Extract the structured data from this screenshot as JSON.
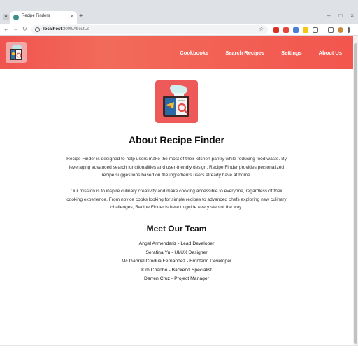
{
  "browser": {
    "tab_title": "Recipe Finders",
    "tab_close": "×",
    "new_tab": "+",
    "url_host": "localhost",
    "url_path": ":3000/AboutUs",
    "window_controls": [
      "–",
      "□",
      "×"
    ],
    "nav_back": "←",
    "nav_forward": "→",
    "nav_reload": "↻",
    "star": "☆"
  },
  "header": {
    "nav": [
      "Cookbooks",
      "Search Recipes",
      "Settings",
      "About Us"
    ]
  },
  "about": {
    "title": "About Recipe Finder",
    "paragraph1": "Recipe Finder is designed to help users make the most of their kitchen pantry while reducing food waste. By leveraging advanced search functionalities and user-friendly design, Recipe Finder provides personalized recipe suggestions based on the ingredients users already have at home.",
    "paragraph2": "Our mission is to inspire culinary creativity and make cooking accessible to everyone, regardless of their cooking experience. From novice cooks looking for simple recipes to advanced chefs exploring new culinary challenges, Recipe Finder is here to guide every step of the way."
  },
  "team": {
    "title": "Meet Our Team",
    "members": [
      "Angel Armendariz - Lead Developer",
      "Serafina Yu - UI/UX Designer",
      "Mc Gabriel Crodua Fernandez - Frontend Developer",
      "Kim Chanho - Backend Specialist",
      "Darren Cruz - Project Manager"
    ]
  },
  "colors": {
    "header_start": "#f0544f",
    "header_end": "#f2564e",
    "logo_bg": "#ee5a5a"
  }
}
